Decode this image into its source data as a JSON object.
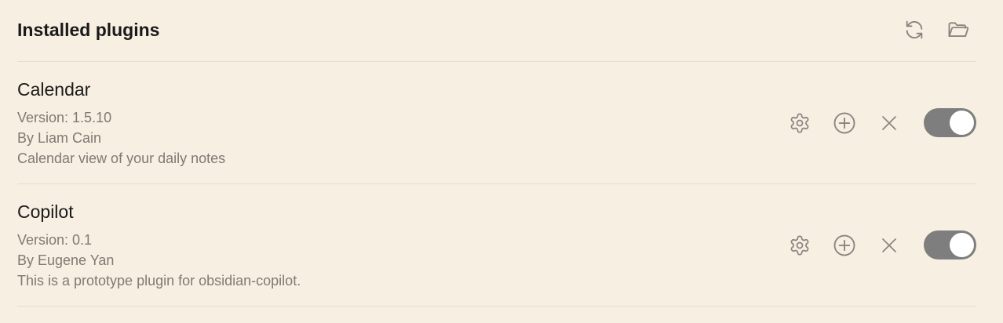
{
  "header": {
    "title": "Installed plugins",
    "reload_icon": "refresh-icon",
    "folder_icon": "folder-open-icon"
  },
  "plugins": [
    {
      "name": "Calendar",
      "version": "Version: 1.5.10",
      "author": "By Liam Cain",
      "description": "Calendar view of your daily notes",
      "enabled": true
    },
    {
      "name": "Copilot",
      "version": "Version: 0.1",
      "author": "By Eugene Yan",
      "description": "This is a prototype plugin for obsidian-copilot.",
      "enabled": true
    }
  ],
  "colors": {
    "background": "#f7efe2",
    "toggle_on": "#7e7e7e",
    "icon": "#8a8580",
    "meta_text": "#7f7a72"
  }
}
